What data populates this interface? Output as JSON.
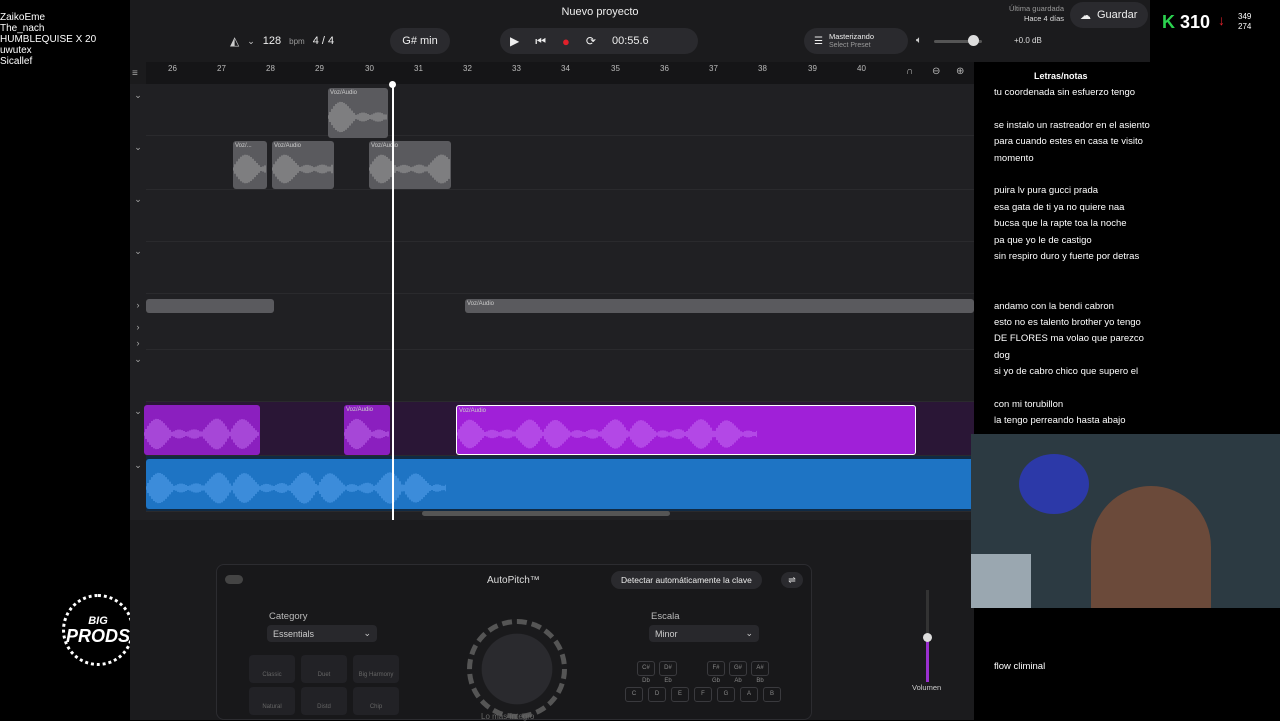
{
  "overlay": {
    "users": [
      "ZaikoEme",
      "The_nach",
      "HUMBLEQUISE X 20",
      "uwutex",
      "Sicallef"
    ],
    "logo_top": "BIG",
    "logo_bottom": "PRODS",
    "kick_score": "310",
    "stat_up": "349",
    "stat_down": "274"
  },
  "topbar": {
    "project_title": "Nuevo proyecto",
    "saved_label": "Última guardada",
    "saved_time": "Hace 4 días",
    "save_button": "Guardar",
    "bpm_value": "128",
    "bpm_unit": "bpm",
    "time_signature": "4 / 4",
    "key": "G# min",
    "time_display": "00:55.6",
    "mastering_label": "Masterizando",
    "preset_label": "Select Preset",
    "volume_db": "+0.0 dB"
  },
  "ruler": {
    "marks": [
      "26",
      "27",
      "28",
      "29",
      "30",
      "31",
      "32",
      "33",
      "34",
      "35",
      "36",
      "37",
      "38",
      "39",
      "40"
    ]
  },
  "clips": {
    "c1": "Voz/Audio",
    "c2": "Voz/...",
    "c3": "Voz/Audio",
    "c4": "Voz/Audio",
    "c5": "Voz/Audio",
    "c6": "Voz/Audio",
    "c7": "Voz/Audio"
  },
  "lyrics": {
    "title": "Letras/notas",
    "lines": [
      "tu coordenada sin esfuerzo tengo",
      "se instalo un rastreador en el asiento",
      "para cuando estes en casa te visito",
      "momento",
      "puira lv pura gucci prada",
      "esa gata de ti ya no quiere naa",
      "bucsa que la rapte toa la noche",
      "pa que yo le de castigo",
      "sin respiro duro y fuerte   por detras",
      "andamo con la bendi cabron",
      "esto no es talento brother yo tengo",
      " DE FLORES ma volao que parezco",
      "dog",
      "si yo de cabro chico que supero el",
      "con mi torubillon",
      "la tengo perreando hasta abajo",
      "flow climinal"
    ]
  },
  "autopitch": {
    "title": "AutoPitch™",
    "detect_button": "Detectar automáticamente la clave",
    "category_label": "Category",
    "category_value": "Essentials",
    "scale_label": "Escala",
    "scale_value": "Minor",
    "presets": [
      "Classic",
      "Duet",
      "Big Harmony",
      "Natural",
      "Distd",
      "Chip"
    ],
    "keys_sharp": [
      "C#\nDb",
      "D#\nEb",
      "F#\nGb",
      "G#\nAb",
      "A#\nBb"
    ],
    "keys_natural": [
      "C",
      "D",
      "E",
      "F",
      "G",
      "A",
      "B"
    ],
    "knob_hint": "Lo más íntegro",
    "volume_label": "Volumen"
  }
}
